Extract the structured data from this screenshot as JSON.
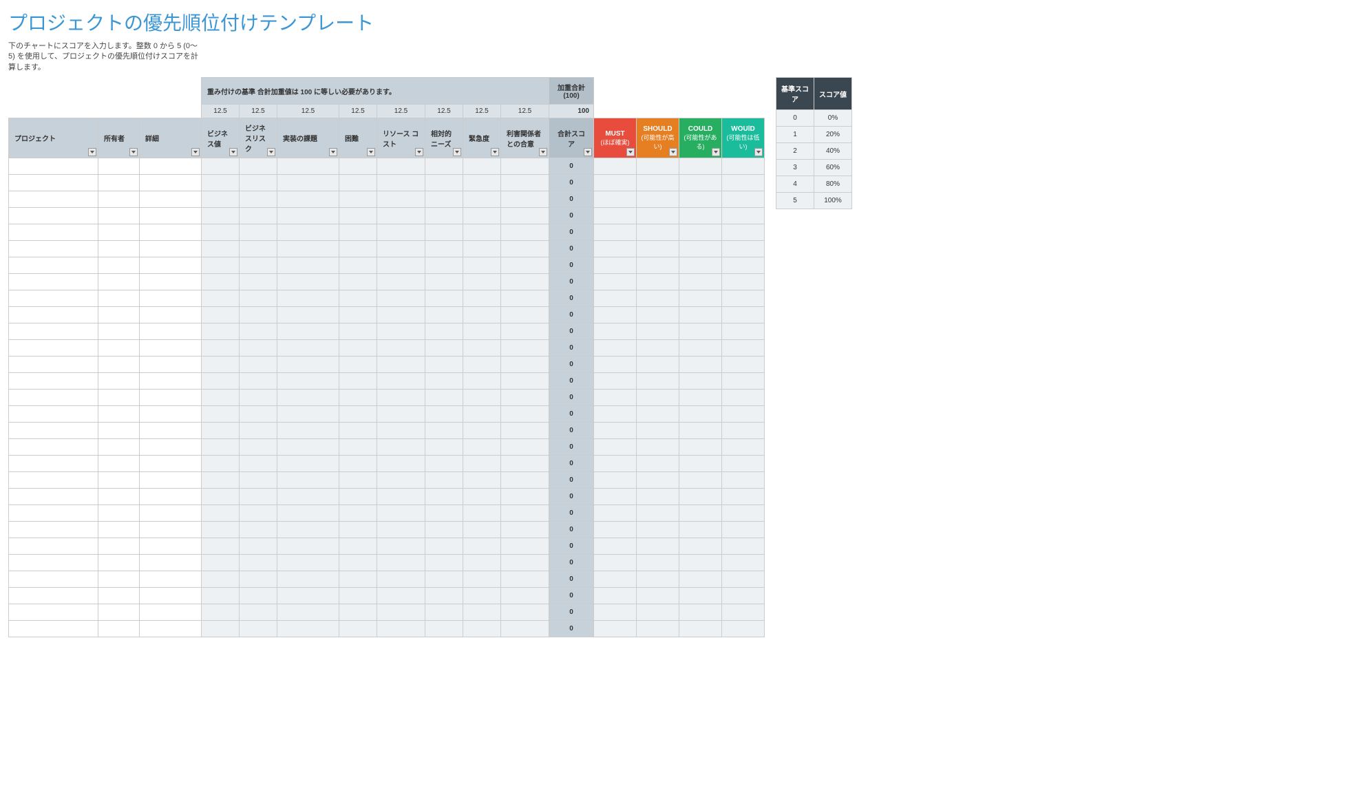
{
  "title": "プロジェクトの優先順位付けテンプレート",
  "description": "下のチャートにスコアを入力します。整数 0 から 5 (0～5) を使用して、プロジェクトの優先順位付けスコアを計算します。",
  "weighting": {
    "label": "重み付けの基準",
    "note": "合計加重値は 100 に等しい必要があります。",
    "total_label": "加重合計 (100)",
    "weights": [
      "12.5",
      "12.5",
      "12.5",
      "12.5",
      "12.5",
      "12.5",
      "12.5",
      "12.5"
    ],
    "total_value": "100"
  },
  "columns": {
    "project": "プロジェクト",
    "owner": "所有者",
    "details": "詳細",
    "criteria": [
      "ビジネス値",
      "ビジネスリスク",
      "実装の課題",
      "困難",
      "リソース コスト",
      "相対的ニーズ",
      "緊急度",
      "利害関係者との合意"
    ],
    "total_score": "合計スコア"
  },
  "moscow": {
    "must": {
      "label": "MUST",
      "sub": "(ほぼ確実)"
    },
    "should": {
      "label": "SHOULD",
      "sub": "(可能性が高い)"
    },
    "could": {
      "label": "COULD",
      "sub": "(可能性がある)"
    },
    "would": {
      "label": "WOUlD",
      "sub": "(可能性は低い)"
    }
  },
  "row_score_default": "0",
  "row_count": 29,
  "scale": {
    "header_score": "基準スコア",
    "header_value": "スコア値",
    "rows": [
      {
        "s": "0",
        "v": "0%"
      },
      {
        "s": "1",
        "v": "20%"
      },
      {
        "s": "2",
        "v": "40%"
      },
      {
        "s": "3",
        "v": "60%"
      },
      {
        "s": "4",
        "v": "80%"
      },
      {
        "s": "5",
        "v": "100%"
      }
    ]
  },
  "col_widths": {
    "project": 130,
    "owner": 60,
    "details": 90,
    "crit": [
      55,
      55,
      90,
      55,
      70,
      55,
      55,
      70
    ],
    "score": 65,
    "moscow": 62,
    "scale": 55
  }
}
